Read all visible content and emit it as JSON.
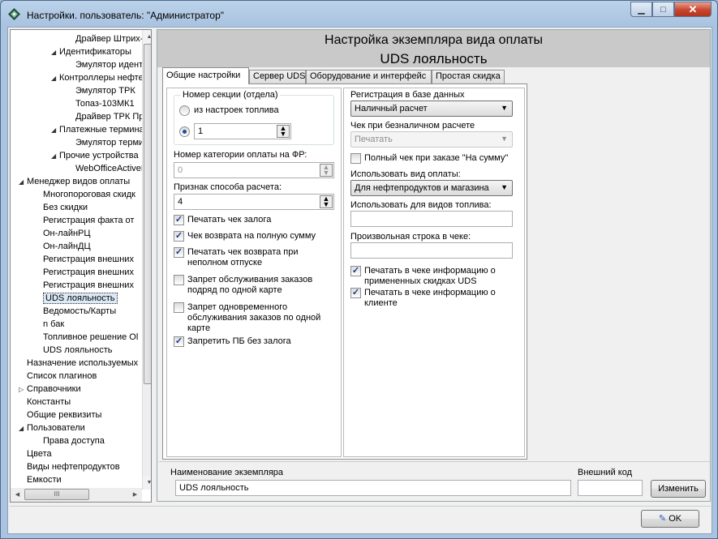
{
  "window": {
    "title": "Настройки. пользователь: \"Администратор\"",
    "minimize": "▁",
    "maximize": "□",
    "close": "✕"
  },
  "tree": {
    "items": [
      {
        "label": "Драйвер Штрих-М"
      },
      {
        "label": "Идентификаторы",
        "arrow": "◢"
      },
      {
        "label": "Эмулятор идентиф"
      },
      {
        "label": "Контроллеры нефтепр",
        "arrow": "◢"
      },
      {
        "label": "Эмулятор ТРК"
      },
      {
        "label": "Топаз-103МК1"
      },
      {
        "label": "Драйвер ТРК Прот"
      },
      {
        "label": "Платежные терминал",
        "arrow": "◢"
      },
      {
        "label": "Эмулятор термина"
      },
      {
        "label": "Прочие устройства",
        "arrow": "◢"
      },
      {
        "label": "WebOfficeActiveDe"
      },
      {
        "label": "Менеджер видов оплаты",
        "arrow": "◢"
      },
      {
        "label": "Многопороговая скидк"
      },
      {
        "label": "Без скидки"
      },
      {
        "label": "Регистрация факта от"
      },
      {
        "label": "Он-лайнРЦ"
      },
      {
        "label": "Он-лайнДЦ"
      },
      {
        "label": "Регистрация внешних"
      },
      {
        "label": "Регистрация внешних"
      },
      {
        "label": "Регистрация внешних"
      },
      {
        "label": "UDS лояльность"
      },
      {
        "label": "Ведомость/Карты"
      },
      {
        "label": "n бак"
      },
      {
        "label": "Топливное решение Ol"
      },
      {
        "label": "UDS лояльность"
      },
      {
        "label": "Назначение используемых"
      },
      {
        "label": "Список плагинов"
      },
      {
        "label": "Справочники",
        "arrow": "▷"
      },
      {
        "label": "Константы"
      },
      {
        "label": "Общие реквизиты"
      },
      {
        "label": "Пользователи",
        "arrow": "◢"
      },
      {
        "label": "Права доступа"
      },
      {
        "label": "Цвета"
      },
      {
        "label": "Виды нефтепродуктов"
      },
      {
        "label": "Емкости"
      }
    ],
    "hscroll_grip": "III"
  },
  "header": {
    "title": "Настройка экземпляра вида оплаты",
    "subtitle": "UDS лояльность"
  },
  "tabs": [
    {
      "label": "Общие настройки"
    },
    {
      "label": "Сервер UDS"
    },
    {
      "label": "Оборудование и интерфейс"
    },
    {
      "label": "Простая скидка"
    }
  ],
  "left": {
    "section_group_label": "Номер секции (отдела)",
    "radio_fuel_label": "из настроек топлива",
    "section_value": "1",
    "fr_category_label": "Номер категории оплаты на ФР:",
    "fr_category_value": "0",
    "calc_sign_label": "Признак способа расчета:",
    "calc_sign_value": "4",
    "checkboxes": [
      {
        "label": "Печатать чек залога",
        "checked": true
      },
      {
        "label": "Чек возврата на полную сумму",
        "checked": true
      },
      {
        "label": "Печатать чек возврата при неполном отпуске",
        "checked": true
      },
      {
        "label": "Запрет обслуживания заказов подряд по одной карте",
        "checked": false
      },
      {
        "label": "Запрет одновременного обслуживания заказов по одной карте",
        "checked": false
      },
      {
        "label": "Запретить ПБ без залога",
        "checked": true
      }
    ]
  },
  "right": {
    "db_reg_label": "Регистрация в базе данных",
    "db_reg_value": "Наличный расчет",
    "cashless_label": "Чек при безналичном расчете",
    "cashless_value": "Печатать",
    "full_check_label": "Полный чек при заказе \"На сумму\"",
    "use_payment_label": "Использовать вид оплаты:",
    "use_payment_value": "Для нефтепродуктов и магазина",
    "fuel_types_label": "Использовать для видов топлива:",
    "fuel_types_value": "",
    "free_line_label": "Произвольная строка в чеке:",
    "free_line_value": "",
    "print_discounts_label": "Печатать в чеке информацию о примененных скидках UDS",
    "print_client_label": "Печатать в чеке информацию о клиенте"
  },
  "bottom": {
    "name_label": "Наименование экземпляра",
    "name_value": "UDS лояльность",
    "ext_code_label": "Внешний код",
    "ext_code_value": "",
    "change_button": "Изменить"
  },
  "ok_button": "OK"
}
